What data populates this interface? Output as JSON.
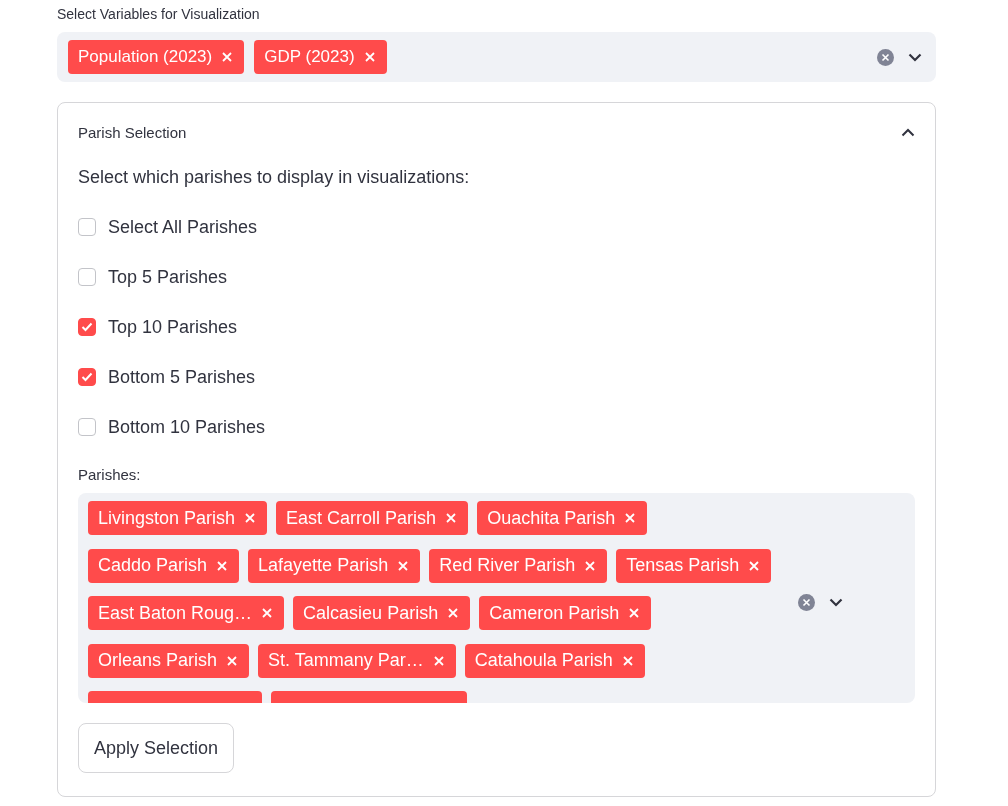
{
  "variables": {
    "label": "Select Variables for Visualization",
    "selected": [
      "Population (2023)",
      "GDP (2023)"
    ]
  },
  "parish_selection": {
    "title": "Parish Selection",
    "expanded": true,
    "instruction": "Select which parishes to display in visualizations:",
    "options": [
      {
        "label": "Select All Parishes",
        "checked": false
      },
      {
        "label": "Top 5 Parishes",
        "checked": false
      },
      {
        "label": "Top 10 Parishes",
        "checked": true
      },
      {
        "label": "Bottom 5 Parishes",
        "checked": true
      },
      {
        "label": "Bottom 10 Parishes",
        "checked": false
      }
    ],
    "parishes_label": "Parishes:",
    "parishes": [
      "Livingston Parish",
      "East Carroll Parish",
      "Ouachita Parish",
      "Caddo Parish",
      "Lafayette Parish",
      "Red River Parish",
      "Tensas Parish",
      "East Baton Roug…",
      "Calcasieu Parish",
      "Cameron Parish",
      "Orleans Parish",
      "St. Tammany Par…",
      "Catahoula Parish"
    ],
    "apply_button": "Apply Selection"
  }
}
